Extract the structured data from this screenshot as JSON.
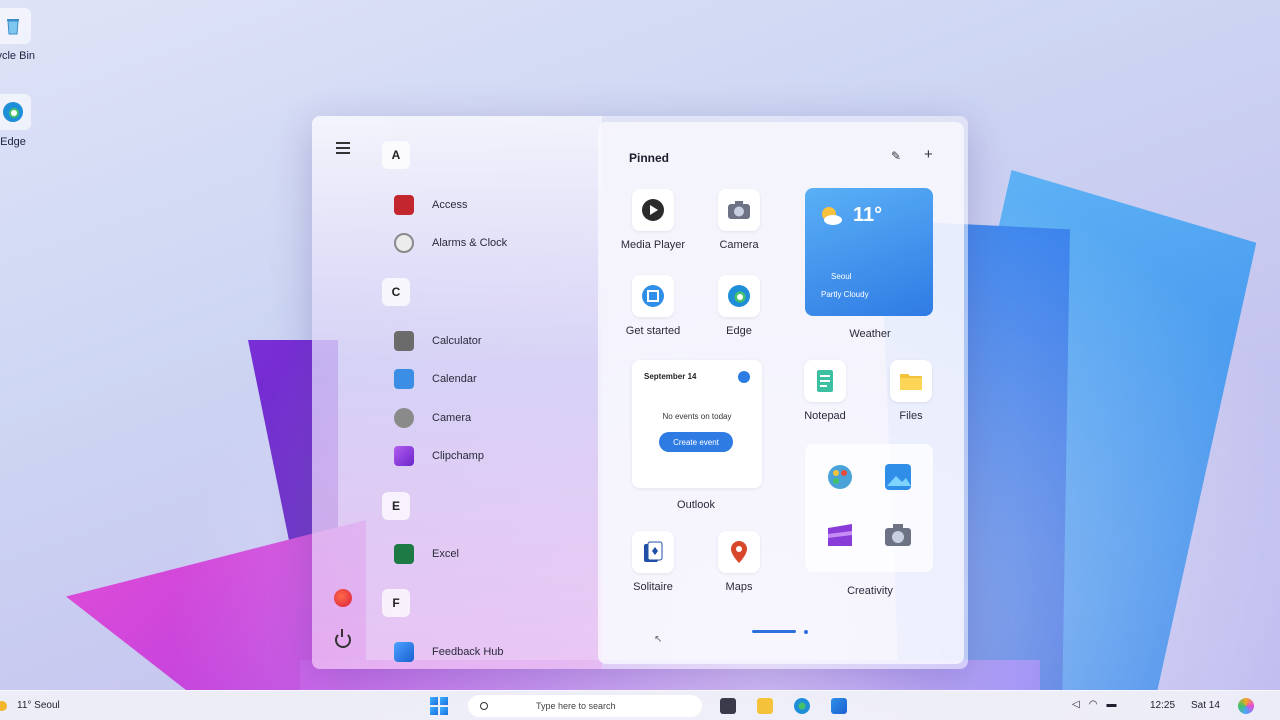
{
  "desktop": {
    "icons": [
      {
        "label": "cycle Bin",
        "icon": "recycle-bin-icon"
      },
      {
        "label": "Edge",
        "icon": "edge-icon"
      }
    ]
  },
  "start": {
    "rail": {
      "menu_icon": "hamburger-icon",
      "copilot_icon": "copilot-icon",
      "power_icon": "power-icon"
    },
    "groups": [
      {
        "letter": "A",
        "apps": [
          {
            "label": "Access",
            "icon": "access-icon",
            "color": "#c4262e"
          },
          {
            "label": "Alarms & Clock",
            "icon": "clock-icon",
            "color": "#8a8a8a"
          }
        ]
      },
      {
        "letter": "C",
        "apps": [
          {
            "label": "Calculator",
            "icon": "calculator-icon",
            "color": "#6b6b6b"
          },
          {
            "label": "Calendar",
            "icon": "calendar-icon",
            "color": "#3a8ee6"
          },
          {
            "label": "Camera",
            "icon": "camera-icon",
            "color": "#6b6b6b"
          },
          {
            "label": "Clipchamp",
            "icon": "clipchamp-icon",
            "color": "#8a3cd8"
          }
        ]
      },
      {
        "letter": "E",
        "apps": [
          {
            "label": "Excel",
            "icon": "excel-icon",
            "color": "#1d7a45"
          }
        ]
      },
      {
        "letter": "F",
        "apps": [
          {
            "label": "Feedback Hub",
            "icon": "feedback-hub-icon",
            "color": "#2e7be0"
          }
        ]
      }
    ],
    "pinned": {
      "title": "Pinned",
      "edit_icon": "pencil-icon",
      "add_icon": "plus-icon",
      "apps": [
        {
          "label": "Media Player",
          "icon": "media-player-icon"
        },
        {
          "label": "Camera",
          "icon": "camera-icon"
        },
        {
          "label": "Get started",
          "icon": "get-started-icon"
        },
        {
          "label": "Edge",
          "icon": "edge-icon"
        },
        {
          "label": "Notepad",
          "icon": "notepad-icon"
        },
        {
          "label": "Files",
          "icon": "folder-icon"
        },
        {
          "label": "Solitaire",
          "icon": "solitaire-icon"
        },
        {
          "label": "Maps",
          "icon": "maps-icon"
        }
      ],
      "weather": {
        "temp": "11°",
        "city": "Seoul",
        "condition": "Partly Cloudy",
        "label": "Weather"
      },
      "outlook": {
        "date": "September 14",
        "message": "No events on today",
        "button": "Create event",
        "label": "Outlook"
      },
      "creativity": {
        "label": "Creativity",
        "icons": [
          "paint-icon",
          "photos-icon",
          "clipchamp-icon",
          "camera-icon"
        ]
      }
    }
  },
  "taskbar": {
    "weather": "11° Seoul",
    "search_placeholder": "Type here to search",
    "apps": [
      "task-view-icon",
      "file-explorer-icon",
      "edge-icon",
      "store-icon"
    ],
    "time": "12:25",
    "date": "Sat 14"
  },
  "colors": {
    "accent": "#2f7be4"
  }
}
